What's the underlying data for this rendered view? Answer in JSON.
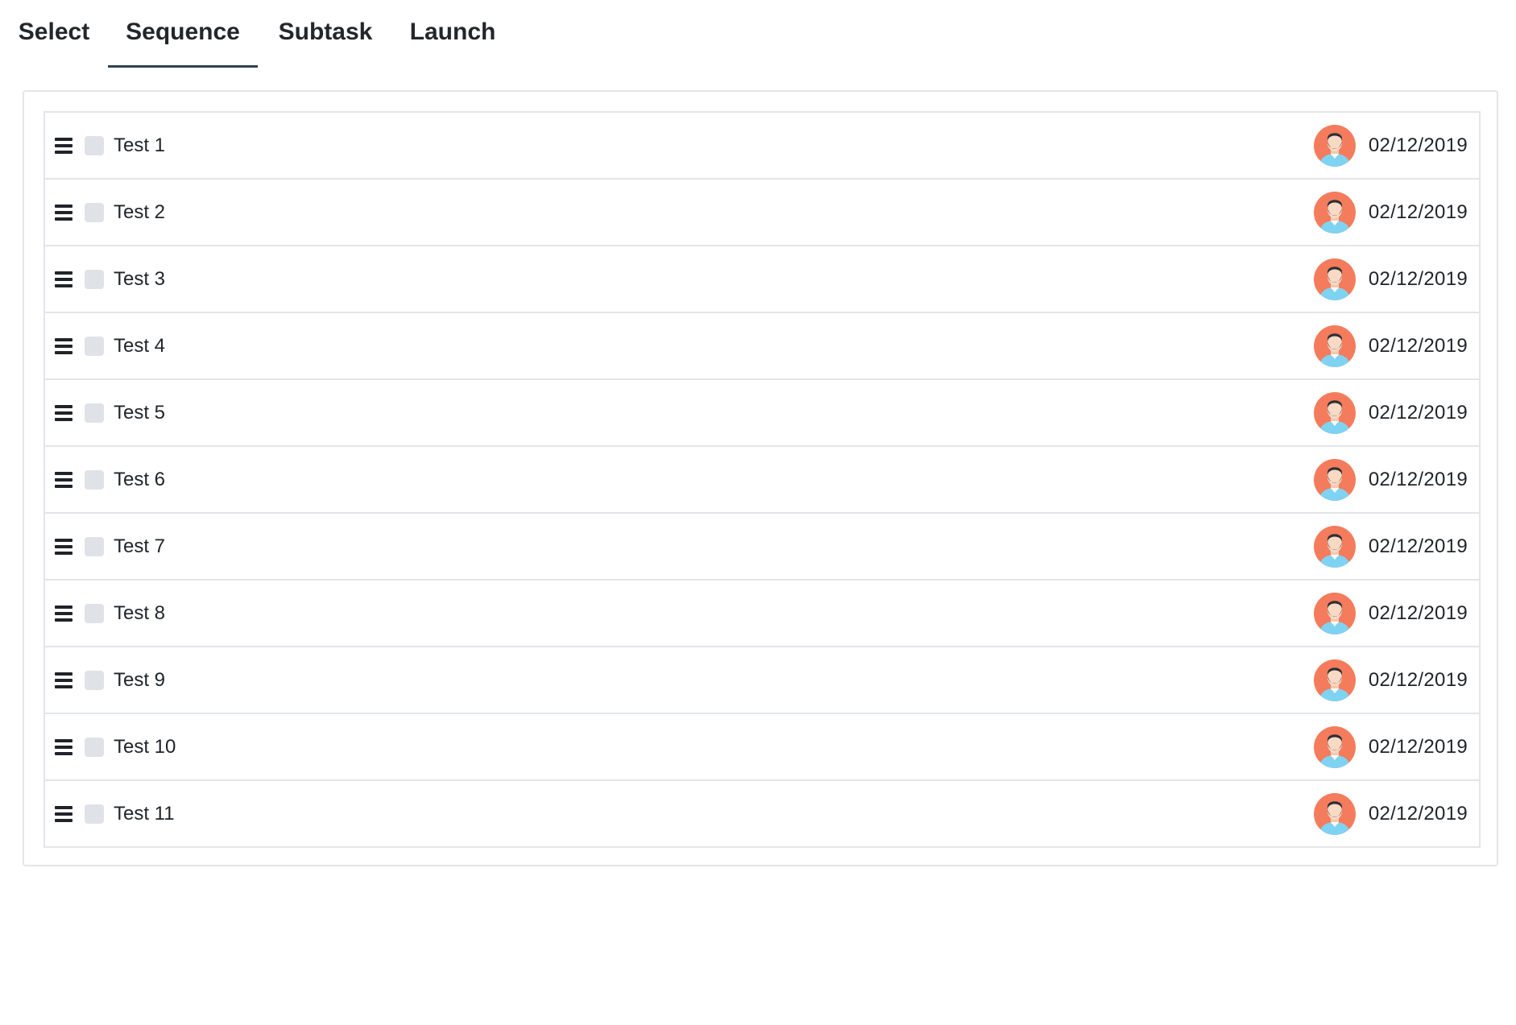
{
  "tabs": [
    {
      "label": "Select",
      "active": false
    },
    {
      "label": "Sequence",
      "active": true
    },
    {
      "label": "Subtask",
      "active": false
    },
    {
      "label": "Launch",
      "active": false
    }
  ],
  "icons": {
    "drag": "drag-handle-icon",
    "avatar": "user-avatar-icon"
  },
  "colors": {
    "active_tab_underline": "#2f4050",
    "avatar_background": "#f47c5c",
    "avatar_shirt": "#7fd3f2",
    "checkbox": "#dfe2e6"
  },
  "rows": [
    {
      "label": "Test 1",
      "date": "02/12/2019",
      "checked": false
    },
    {
      "label": "Test 2",
      "date": "02/12/2019",
      "checked": false
    },
    {
      "label": "Test 3",
      "date": "02/12/2019",
      "checked": false
    },
    {
      "label": "Test 4",
      "date": "02/12/2019",
      "checked": false
    },
    {
      "label": "Test 5",
      "date": "02/12/2019",
      "checked": false
    },
    {
      "label": "Test 6",
      "date": "02/12/2019",
      "checked": false
    },
    {
      "label": "Test 7",
      "date": "02/12/2019",
      "checked": false
    },
    {
      "label": "Test 8",
      "date": "02/12/2019",
      "checked": false
    },
    {
      "label": "Test 9",
      "date": "02/12/2019",
      "checked": false
    },
    {
      "label": "Test 10",
      "date": "02/12/2019",
      "checked": false
    },
    {
      "label": "Test 11",
      "date": "02/12/2019",
      "checked": false
    }
  ]
}
